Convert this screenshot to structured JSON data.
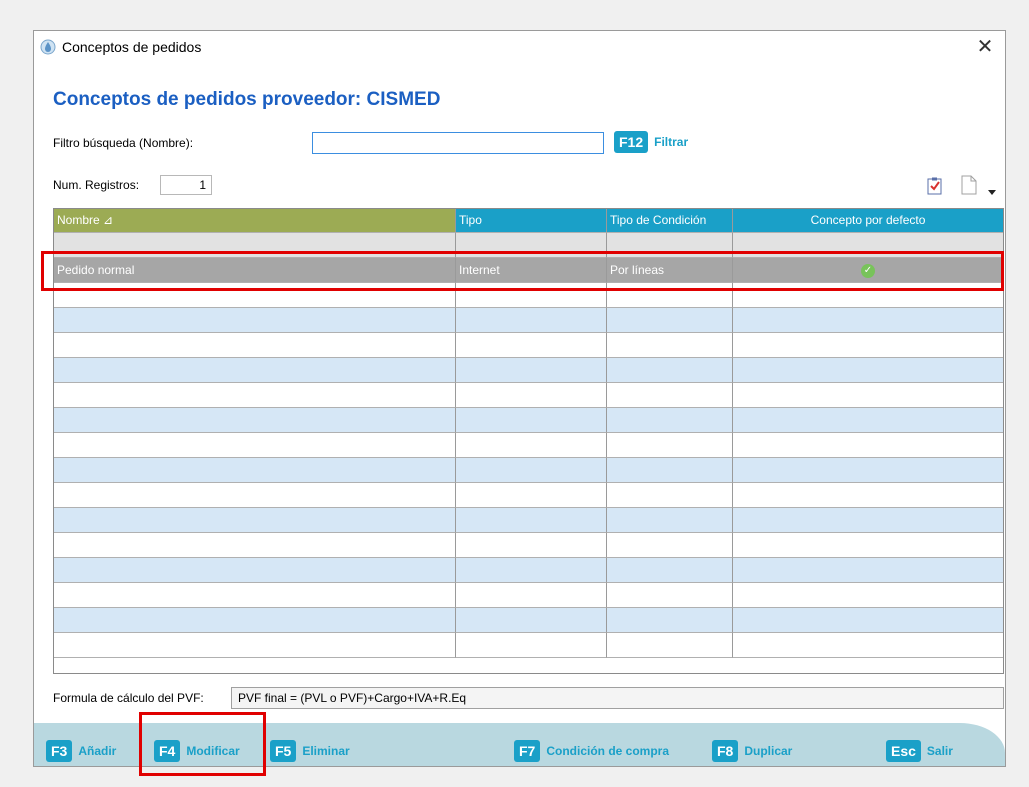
{
  "window": {
    "title": "Conceptos de pedidos",
    "close_glyph": "✕"
  },
  "heading": "Conceptos de pedidos proveedor: CISMED",
  "filter": {
    "label": "Filtro búsqueda (Nombre):",
    "value": "",
    "key": "F12",
    "button_label": "Filtrar"
  },
  "records": {
    "label": "Num. Registros:",
    "count": "1"
  },
  "toolbar": {
    "icons": [
      "checklist-icon",
      "new-document-icon",
      "dropdown-arrow-icon"
    ]
  },
  "grid": {
    "headers": [
      "Nombre",
      "Tipo",
      "Tipo de Condición",
      "Concepto por defecto"
    ],
    "sort_indicator": "⊿",
    "rows": [
      {
        "nombre": "Pedido normal",
        "tipo": "Internet",
        "condicion": "Por líneas",
        "defecto": true
      }
    ]
  },
  "formula": {
    "label": "Formula de cálculo del PVF:",
    "value": "PVF final = (PVL o PVF)+Cargo+IVA+R.Eq"
  },
  "actions": [
    {
      "key": "F3",
      "label": "Añadir"
    },
    {
      "key": "F4",
      "label": "Modificar"
    },
    {
      "key": "F5",
      "label": "Eliminar"
    },
    {
      "key": "F7",
      "label": "Condición de compra"
    },
    {
      "key": "F8",
      "label": "Duplicar"
    },
    {
      "key": "Esc",
      "label": "Salir"
    }
  ],
  "colors": {
    "accent": "#1aa0c8",
    "heading": "#1b5fc2",
    "name_header": "#9cab54",
    "selected_row": "#a6a6a6",
    "alt_row": "#d6e7f6",
    "highlight": "#e00000",
    "bottom_bar": "#b9d8e0"
  }
}
